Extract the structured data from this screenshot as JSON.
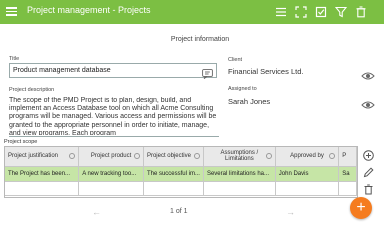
{
  "titlebar": {
    "title": "Project management - Projects",
    "actions": [
      {
        "icon": "list-icon"
      },
      {
        "icon": "fullscreen-icon"
      },
      {
        "icon": "checklist-icon"
      },
      {
        "icon": "filter-icon"
      },
      {
        "icon": "trash-icon"
      }
    ],
    "bg_color": "#7cbf43"
  },
  "form": {
    "section_title": "Project information",
    "title_label": "Title",
    "title_value": "Product management database",
    "client_label": "Client",
    "client_value": "Financial Services Ltd.",
    "assigned_label": "Assigned to",
    "assigned_value": "Sarah Jones",
    "description_label": "Project description",
    "description_value": "The scope of the PMD Project is to plan, design, build, and implement an Access Database tool on which all Acme Consulting programs will be managed. Various access and permissions will be granted to the appropriate personnel in order to initiate, manage, and view programs. Each program"
  },
  "scope": {
    "label": "Project scope",
    "columns": [
      "Project justification",
      "Project product",
      "Project objective",
      "Assumptions / Limitations",
      "Approved by",
      "P"
    ],
    "rows": [
      [
        "The Project has been...",
        "A new tracking too...",
        "The successful im...",
        "Several limitations ha...",
        "John Davis",
        "Sa"
      ]
    ]
  },
  "pager": {
    "text": "1 of 1",
    "prev": "←",
    "next": "→"
  },
  "fab": {
    "label": "+",
    "color": "#f57c1f"
  },
  "tools": [
    {
      "icon": "add-circle-icon"
    },
    {
      "icon": "pencil-icon"
    },
    {
      "icon": "trash-icon"
    }
  ]
}
